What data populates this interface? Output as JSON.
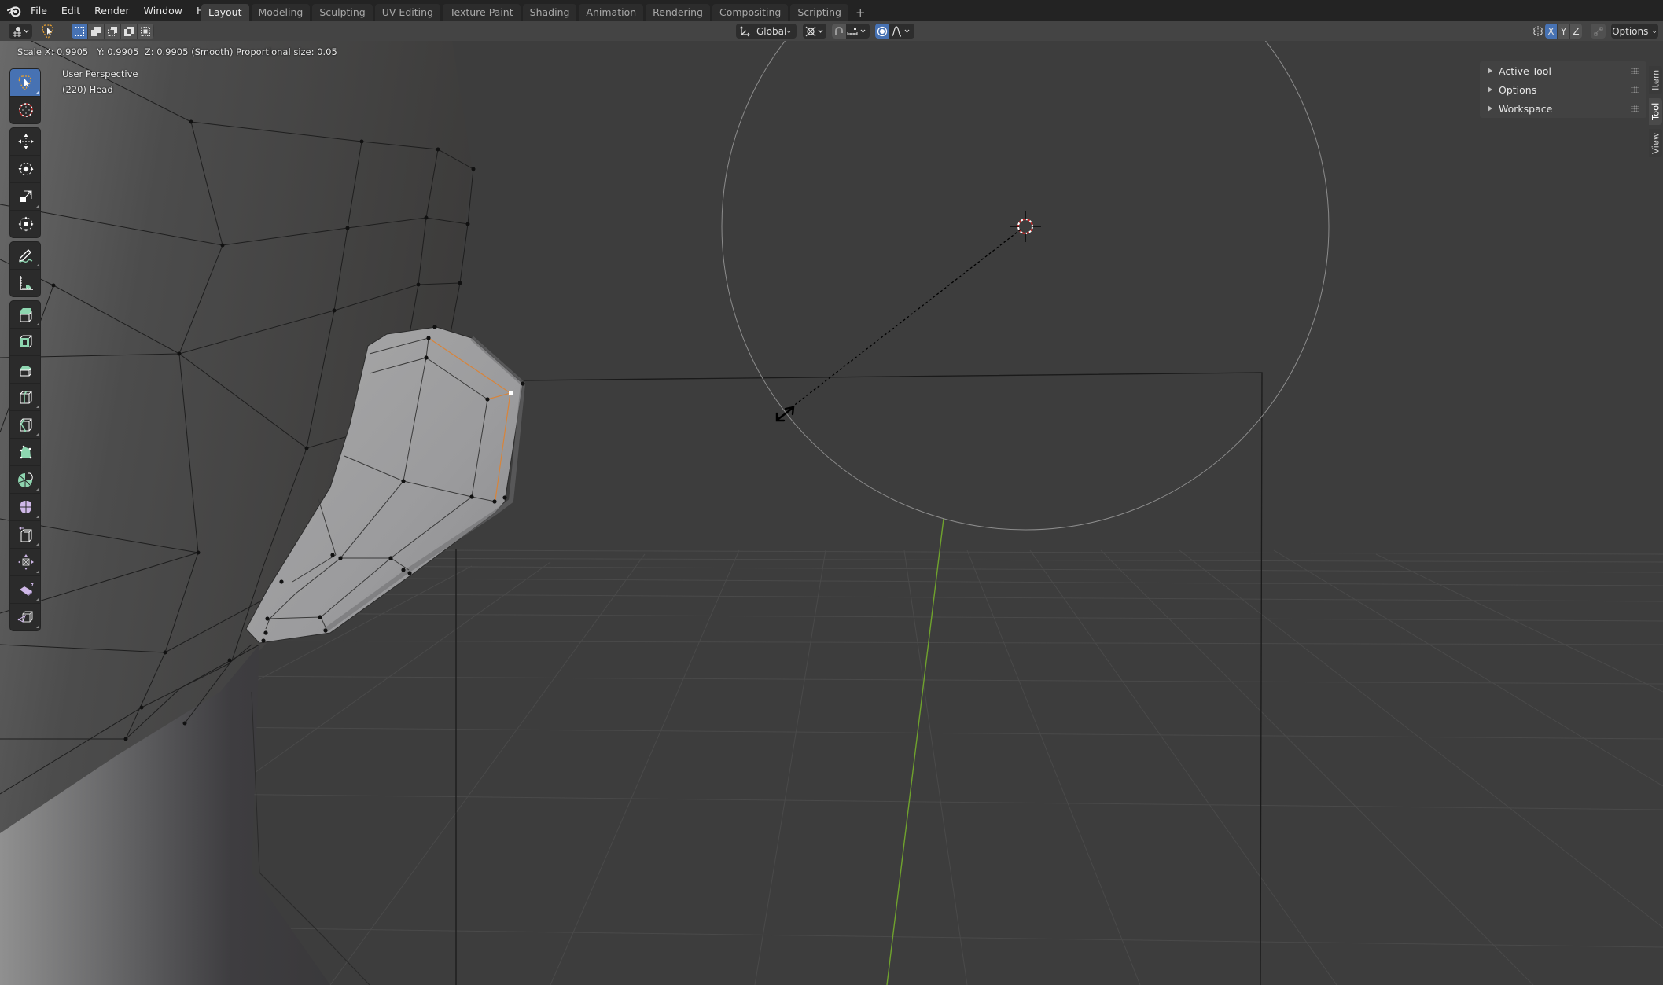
{
  "app": {
    "menu": [
      "File",
      "Edit",
      "Render",
      "Window",
      "Help"
    ],
    "workspaces": [
      {
        "label": "Layout",
        "active": true
      },
      {
        "label": "Modeling",
        "active": false
      },
      {
        "label": "Sculpting",
        "active": false
      },
      {
        "label": "UV Editing",
        "active": false
      },
      {
        "label": "Texture Paint",
        "active": false
      },
      {
        "label": "Shading",
        "active": false
      },
      {
        "label": "Animation",
        "active": false
      },
      {
        "label": "Rendering",
        "active": false
      },
      {
        "label": "Compositing",
        "active": false
      },
      {
        "label": "Scripting",
        "active": false
      }
    ],
    "add_workspace": "+"
  },
  "header": {
    "editor_type_icon": "object-mode-icon",
    "select_tool_icon": "lasso-select-icon",
    "select_modes": [
      "new-selection",
      "extend-selection",
      "subtract-selection",
      "difference-selection",
      "intersect-selection"
    ],
    "active_select_mode": 0,
    "transform_orientation": "Global",
    "pivot_icon": "pivot-point-icon",
    "snap_icon": "snap-magnet-icon",
    "snap_target_icon": "snap-increment-icon",
    "proportional_edit_enabled": true,
    "proportional_falloff_icon": "smooth-falloff-icon",
    "mirror_axes": [
      {
        "label": "X",
        "active": true
      },
      {
        "label": "Y",
        "active": false
      },
      {
        "label": "Z",
        "active": false
      }
    ],
    "options_label": "Options"
  },
  "viewport": {
    "operator_status": "Scale X: 0.9905   Y: 0.9905  Z: 0.9905 (Smooth) Proportional size: 0.05",
    "view_name": "User Perspective",
    "object_info": "(220) Head",
    "accent_color": "#4772b3",
    "selection_color": "#ff9a2e",
    "y_axis_color": "#6fa22d"
  },
  "toolbar": {
    "tools": [
      {
        "name": "select-lasso",
        "group": 0,
        "active": true
      },
      {
        "name": "cursor",
        "group": 0
      },
      {
        "name": "move",
        "group": 1
      },
      {
        "name": "rotate",
        "group": 1
      },
      {
        "name": "scale",
        "group": 1
      },
      {
        "name": "transform",
        "group": 1
      },
      {
        "name": "annotate",
        "group": 2
      },
      {
        "name": "measure",
        "group": 2
      },
      {
        "name": "extrude-region",
        "group": 3
      },
      {
        "name": "inset-faces",
        "group": 3
      },
      {
        "name": "bevel",
        "group": 3
      },
      {
        "name": "loop-cut",
        "group": 3
      },
      {
        "name": "knife",
        "group": 3
      },
      {
        "name": "poly-build",
        "group": 3
      },
      {
        "name": "spin",
        "group": 3
      },
      {
        "name": "smooth",
        "group": 3
      },
      {
        "name": "edge-slide",
        "group": 3
      },
      {
        "name": "shrink-fatten",
        "group": 3
      },
      {
        "name": "shear",
        "group": 3
      },
      {
        "name": "rip-region",
        "group": 3
      }
    ]
  },
  "npanel": {
    "sections": [
      "Active Tool",
      "Options",
      "Workspace"
    ],
    "tabs": [
      {
        "label": "Item",
        "active": false
      },
      {
        "label": "Tool",
        "active": true
      },
      {
        "label": "View",
        "active": false
      }
    ]
  }
}
